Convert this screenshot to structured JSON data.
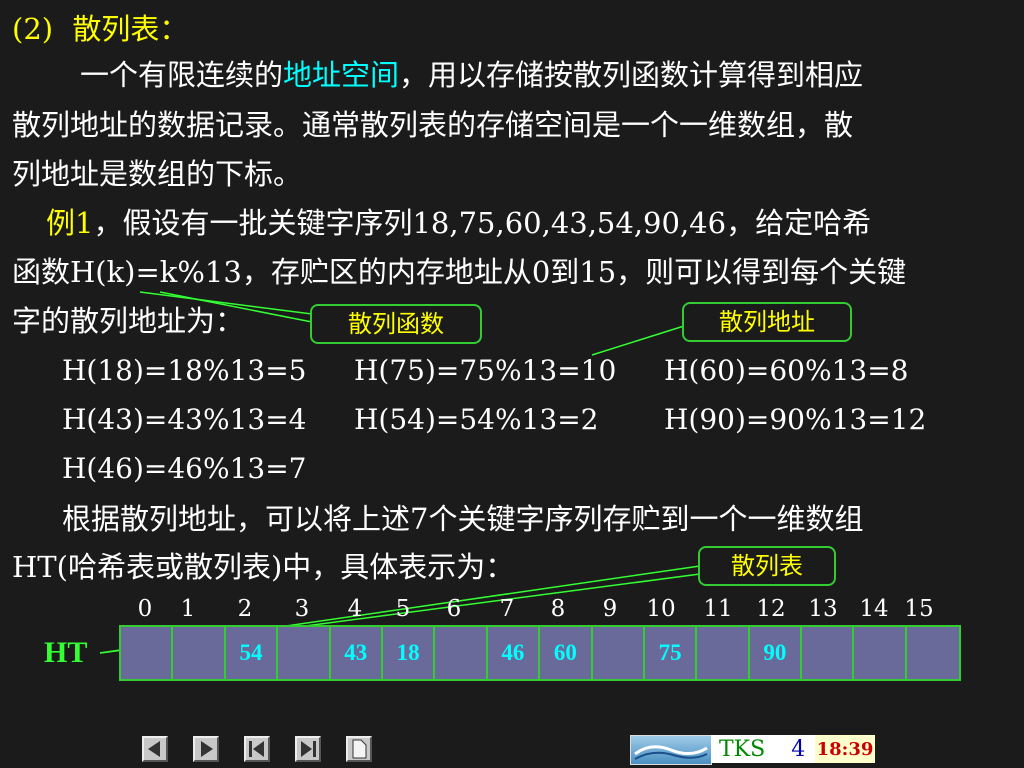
{
  "heading": {
    "number": "(2)",
    "title": "散列表："
  },
  "para1": {
    "line1_a": "一个有限连续的",
    "line1_highlight": "地址空间",
    "line1_b": "，用以存储按散列函数计算得到相应",
    "line2": "散列地址的数据记录。通常散列表的存储空间是一个一维数组，散",
    "line3": "列地址是数组的下标。"
  },
  "example": {
    "label": "例1",
    "line1_rest": "，假设有一批关键字序列18,75,60,43,54,90,46，给定哈希",
    "line2": "函数H(k)=k%13，存贮区的内存地址从0到15，则可以得到每个关键",
    "line3": "字的散列地址为："
  },
  "callouts": {
    "hash_function": "散列函数",
    "hash_address": "散列地址",
    "hash_table": "散列表"
  },
  "formulas": [
    "H(18)=18%13=5",
    "H(75)=75%13=10",
    "H(60)=60%13=8",
    "H(43)=43%13=4",
    "H(54)=54%13=2",
    "H(90)=90%13=12",
    "H(46)=46%13=7"
  ],
  "para2": {
    "line1": "根据散列地址，可以将上述7个关键字序列存贮到一个一维数组",
    "line2": "HT(哈希表或散列表)中，具体表示为："
  },
  "table": {
    "label": "HT",
    "indices": [
      "0",
      "1",
      "2",
      "3",
      "4",
      "5",
      "6",
      "7",
      "8",
      "9",
      "10",
      "11",
      "12",
      "13",
      "14",
      "15"
    ],
    "cells": [
      "",
      "",
      "54",
      "",
      "43",
      "18",
      "",
      "46",
      "60",
      "",
      "75",
      "",
      "90",
      "",
      "",
      ""
    ]
  },
  "footer": {
    "brand": "TKS",
    "page": "4",
    "time": "18:39"
  },
  "colors": {
    "background": "#1b1b1b",
    "highlight_yellow": "#ffff00",
    "highlight_cyan": "#00ffff",
    "border_green": "#33cc33",
    "cell_fill": "#6a6a9a"
  },
  "icons": [
    "prev-slide-icon",
    "next-slide-icon",
    "first-slide-icon",
    "last-slide-icon",
    "document-icon"
  ]
}
